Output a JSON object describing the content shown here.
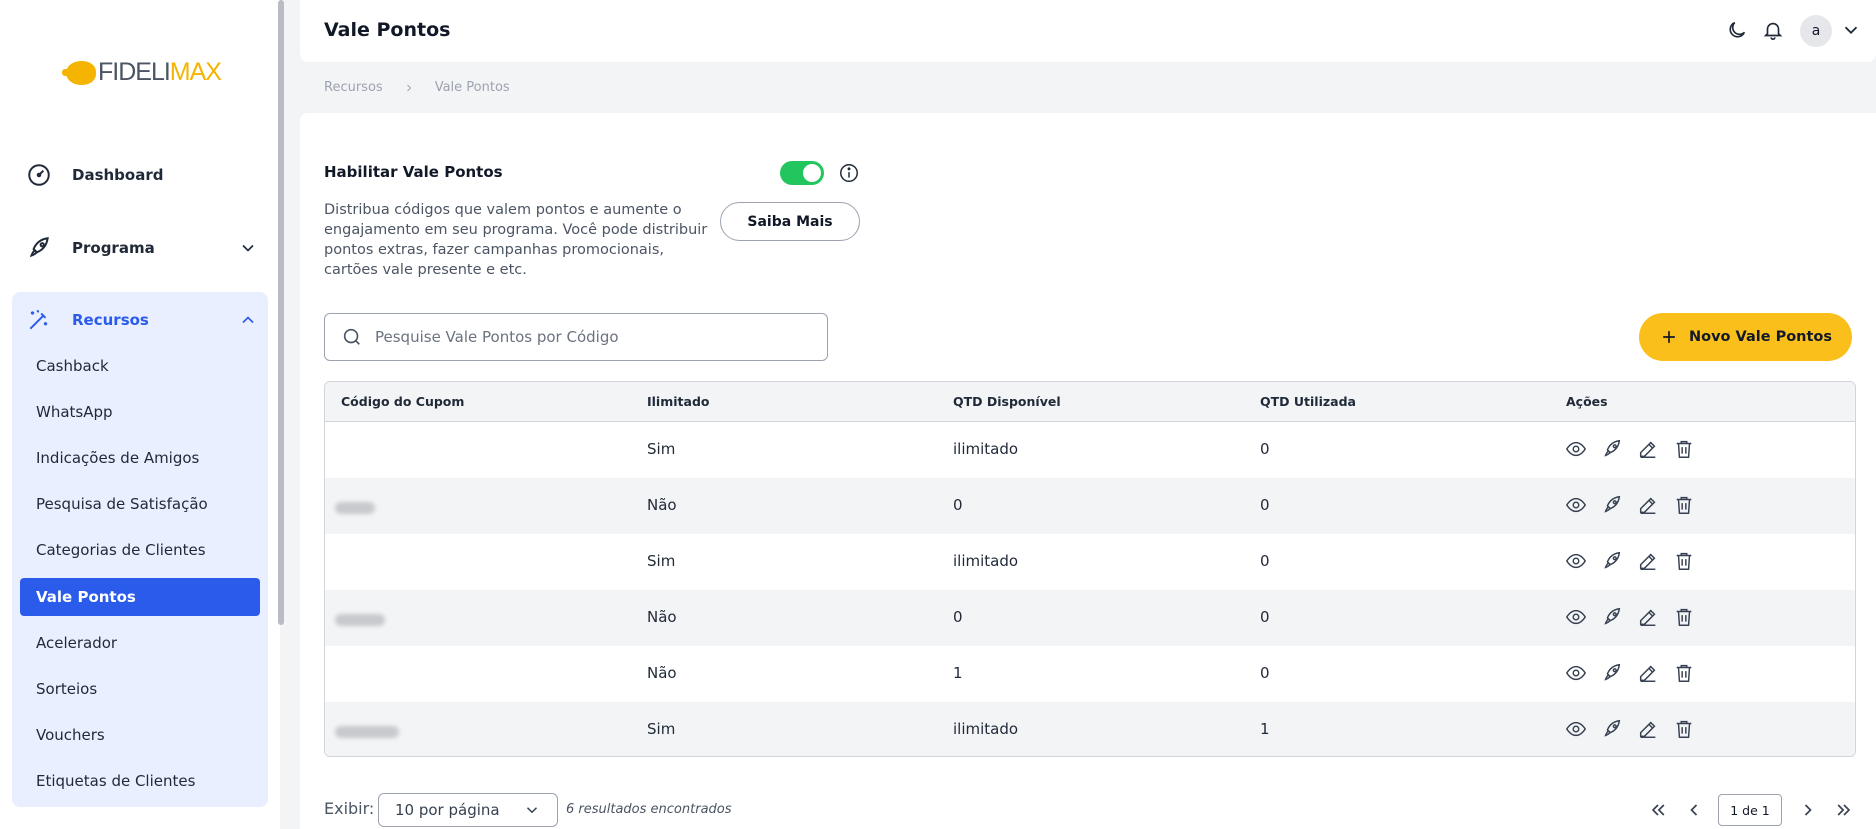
{
  "brand": {
    "logo_left": "FIDELI",
    "logo_right": "MAX"
  },
  "sidebar": {
    "dashboard": "Dashboard",
    "programa": "Programa",
    "recursos": "Recursos",
    "items": [
      "Cashback",
      "WhatsApp",
      "Indicações de Amigos",
      "Pesquisa de Satisfação",
      "Categorias de Clientes",
      "Vale Pontos",
      "Acelerador",
      "Sorteios",
      "Vouchers",
      "Etiquetas de Clientes"
    ],
    "active_item": "Vale Pontos"
  },
  "header": {
    "title": "Vale Pontos",
    "avatar_letter": "a"
  },
  "breadcrumb": {
    "root": "Recursos",
    "current": "Vale Pontos"
  },
  "feature": {
    "label": "Habilitar Vale Pontos",
    "enabled": true,
    "description": "Distribua códigos que valem pontos e aumente o engajamento em seu programa. Você pode distribuir pontos extras, fazer campanhas promocionais, cartões vale presente e etc.",
    "saiba_mais": "Saiba Mais"
  },
  "search": {
    "placeholder": "Pesquise Vale Pontos por Código",
    "value": ""
  },
  "novo_button": "Novo Vale Pontos",
  "table": {
    "columns": [
      "Código do Cupom",
      "Ilimitado",
      "QTD Disponível",
      "QTD Utilizada",
      "Ações"
    ],
    "rows": [
      {
        "code": "",
        "ilimitado": "Sim",
        "disponivel": "ilimitado",
        "utilizada": "0"
      },
      {
        "code": "",
        "ilimitado": "Não",
        "disponivel": "0",
        "utilizada": "0"
      },
      {
        "code": "",
        "ilimitado": "Sim",
        "disponivel": "ilimitado",
        "utilizada": "0"
      },
      {
        "code": "",
        "ilimitado": "Não",
        "disponivel": "0",
        "utilizada": "0"
      },
      {
        "code": "",
        "ilimitado": "Não",
        "disponivel": "1",
        "utilizada": "0"
      },
      {
        "code": "",
        "ilimitado": "Sim",
        "disponivel": "ilimitado",
        "utilizada": "1"
      }
    ]
  },
  "footer": {
    "exibir_label": "Exibir:",
    "per_page": "10 por página",
    "results": "6 resultados encontrados",
    "page_indicator": "1 de 1"
  },
  "colors": {
    "primary": "#2a5bea",
    "accent": "#fbbf1c",
    "toggle_on": "#22c55e",
    "sidebar_group_bg": "#e9efff"
  }
}
